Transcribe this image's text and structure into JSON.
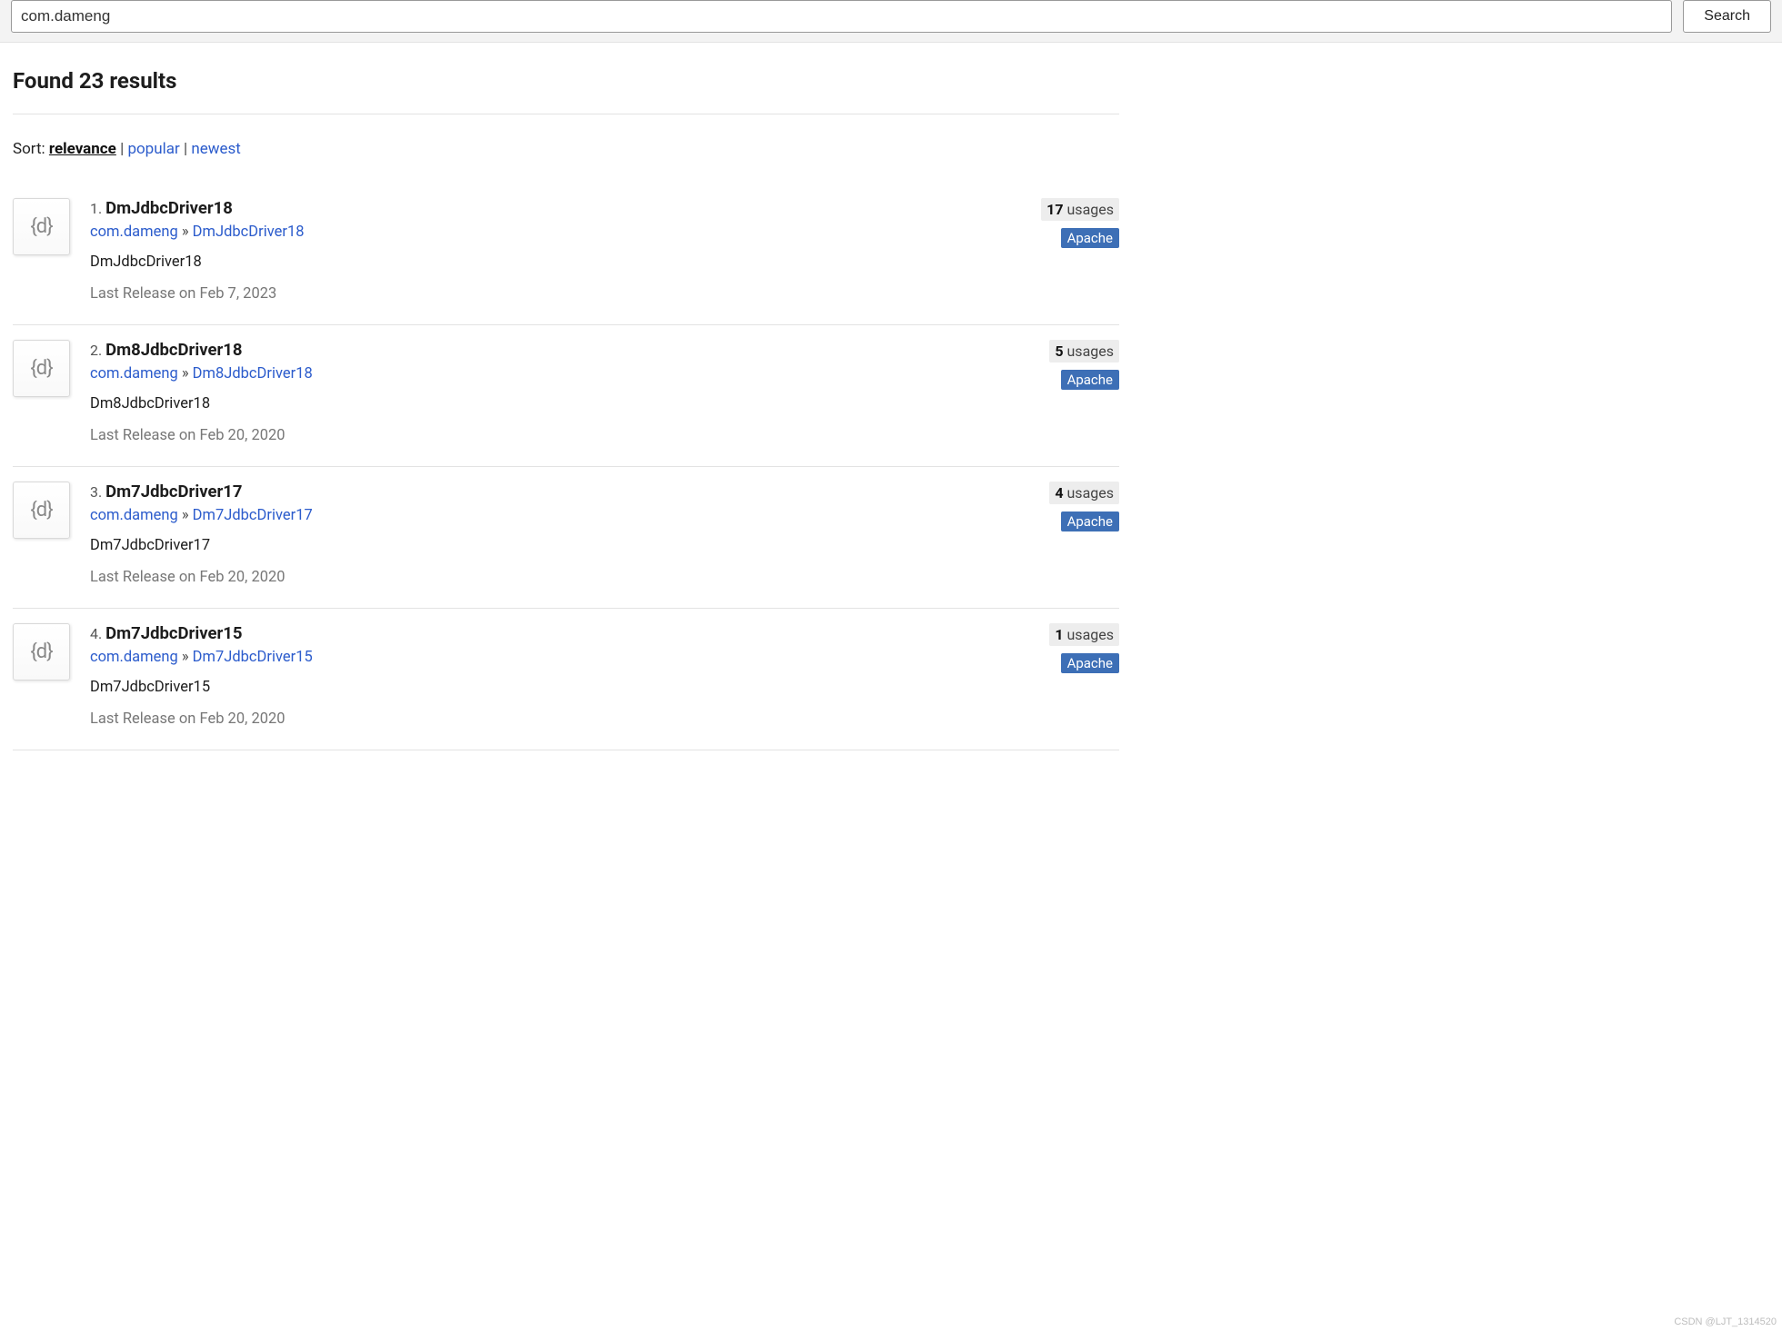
{
  "search": {
    "value": "com.dameng",
    "button_label": "Search"
  },
  "results_heading": "Found 23 results",
  "sort": {
    "label": "Sort:",
    "active": "relevance",
    "popular": "popular",
    "newest": "newest"
  },
  "icon_glyph": "{d}",
  "results": [
    {
      "index": "1.",
      "title": "DmJdbcDriver18",
      "group": "com.dameng",
      "artifact": "DmJdbcDriver18",
      "description": "DmJdbcDriver18",
      "last_release": "Last Release on Feb 7, 2023",
      "usages_count": "17",
      "usages_label": "usages",
      "license": "Apache"
    },
    {
      "index": "2.",
      "title": "Dm8JdbcDriver18",
      "group": "com.dameng",
      "artifact": "Dm8JdbcDriver18",
      "description": "Dm8JdbcDriver18",
      "last_release": "Last Release on Feb 20, 2020",
      "usages_count": "5",
      "usages_label": "usages",
      "license": "Apache"
    },
    {
      "index": "3.",
      "title": "Dm7JdbcDriver17",
      "group": "com.dameng",
      "artifact": "Dm7JdbcDriver17",
      "description": "Dm7JdbcDriver17",
      "last_release": "Last Release on Feb 20, 2020",
      "usages_count": "4",
      "usages_label": "usages",
      "license": "Apache"
    },
    {
      "index": "4.",
      "title": "Dm7JdbcDriver15",
      "group": "com.dameng",
      "artifact": "Dm7JdbcDriver15",
      "description": "Dm7JdbcDriver15",
      "last_release": "Last Release on Feb 20, 2020",
      "usages_count": "1",
      "usages_label": "usages",
      "license": "Apache"
    }
  ],
  "watermark": "CSDN @LJT_1314520"
}
